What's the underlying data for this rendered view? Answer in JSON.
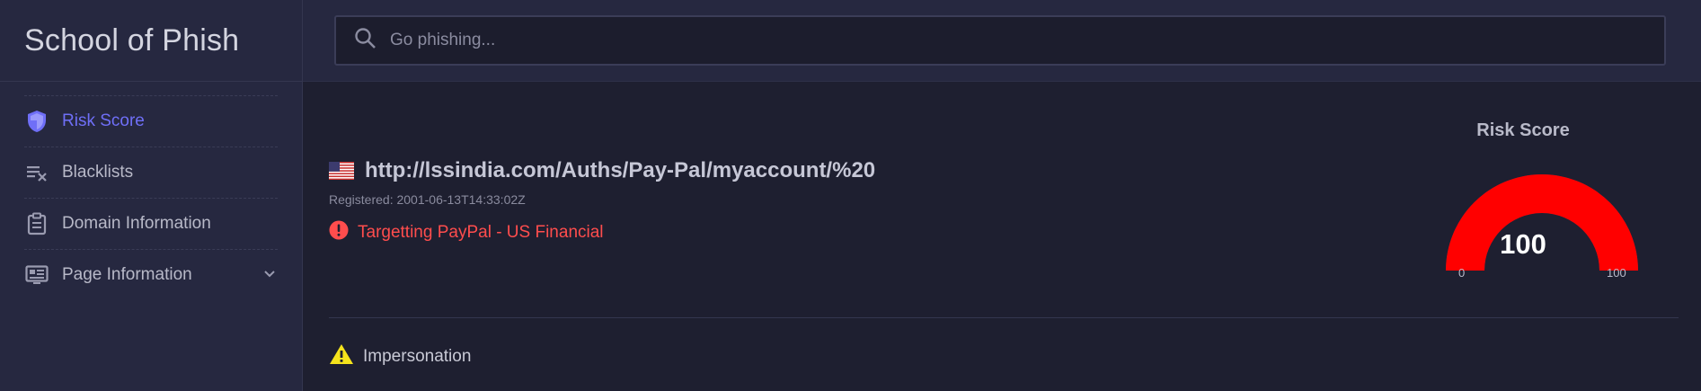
{
  "app": {
    "title": "School of Phish"
  },
  "search": {
    "placeholder": "Go phishing...",
    "value": ""
  },
  "sidebar": {
    "items": [
      {
        "label": "Risk Score",
        "icon": "shield-icon",
        "active": true
      },
      {
        "label": "Blacklists",
        "icon": "list-remove-icon",
        "active": false
      },
      {
        "label": "Domain Information",
        "icon": "clipboard-icon",
        "active": false
      },
      {
        "label": "Page Information",
        "icon": "page-info-icon",
        "active": false,
        "expandable": true
      }
    ]
  },
  "main": {
    "flag_icon": "us-flag-icon",
    "url": "http://lssindia.com/Auths/Pay-Pal/myaccount/%20",
    "registered": "Registered: 2001-06-13T14:33:02Z",
    "alert": {
      "icon": "error-icon",
      "text": "Targetting PayPal - US Financial",
      "color": "#ff4d4d"
    },
    "finding": {
      "icon": "warning-icon",
      "text": "Impersonation",
      "color": "#f5e31c"
    }
  },
  "gauge": {
    "title": "Risk Score",
    "value": "100",
    "min": "0",
    "max": "100",
    "fill_fraction": 1.0,
    "color": "#ff0000"
  },
  "colors": {
    "accent": "#6f6ff7",
    "background": "#1e1f30",
    "sidebar": "#262840",
    "danger": "#ff4d4d",
    "warning": "#f5e31c"
  }
}
